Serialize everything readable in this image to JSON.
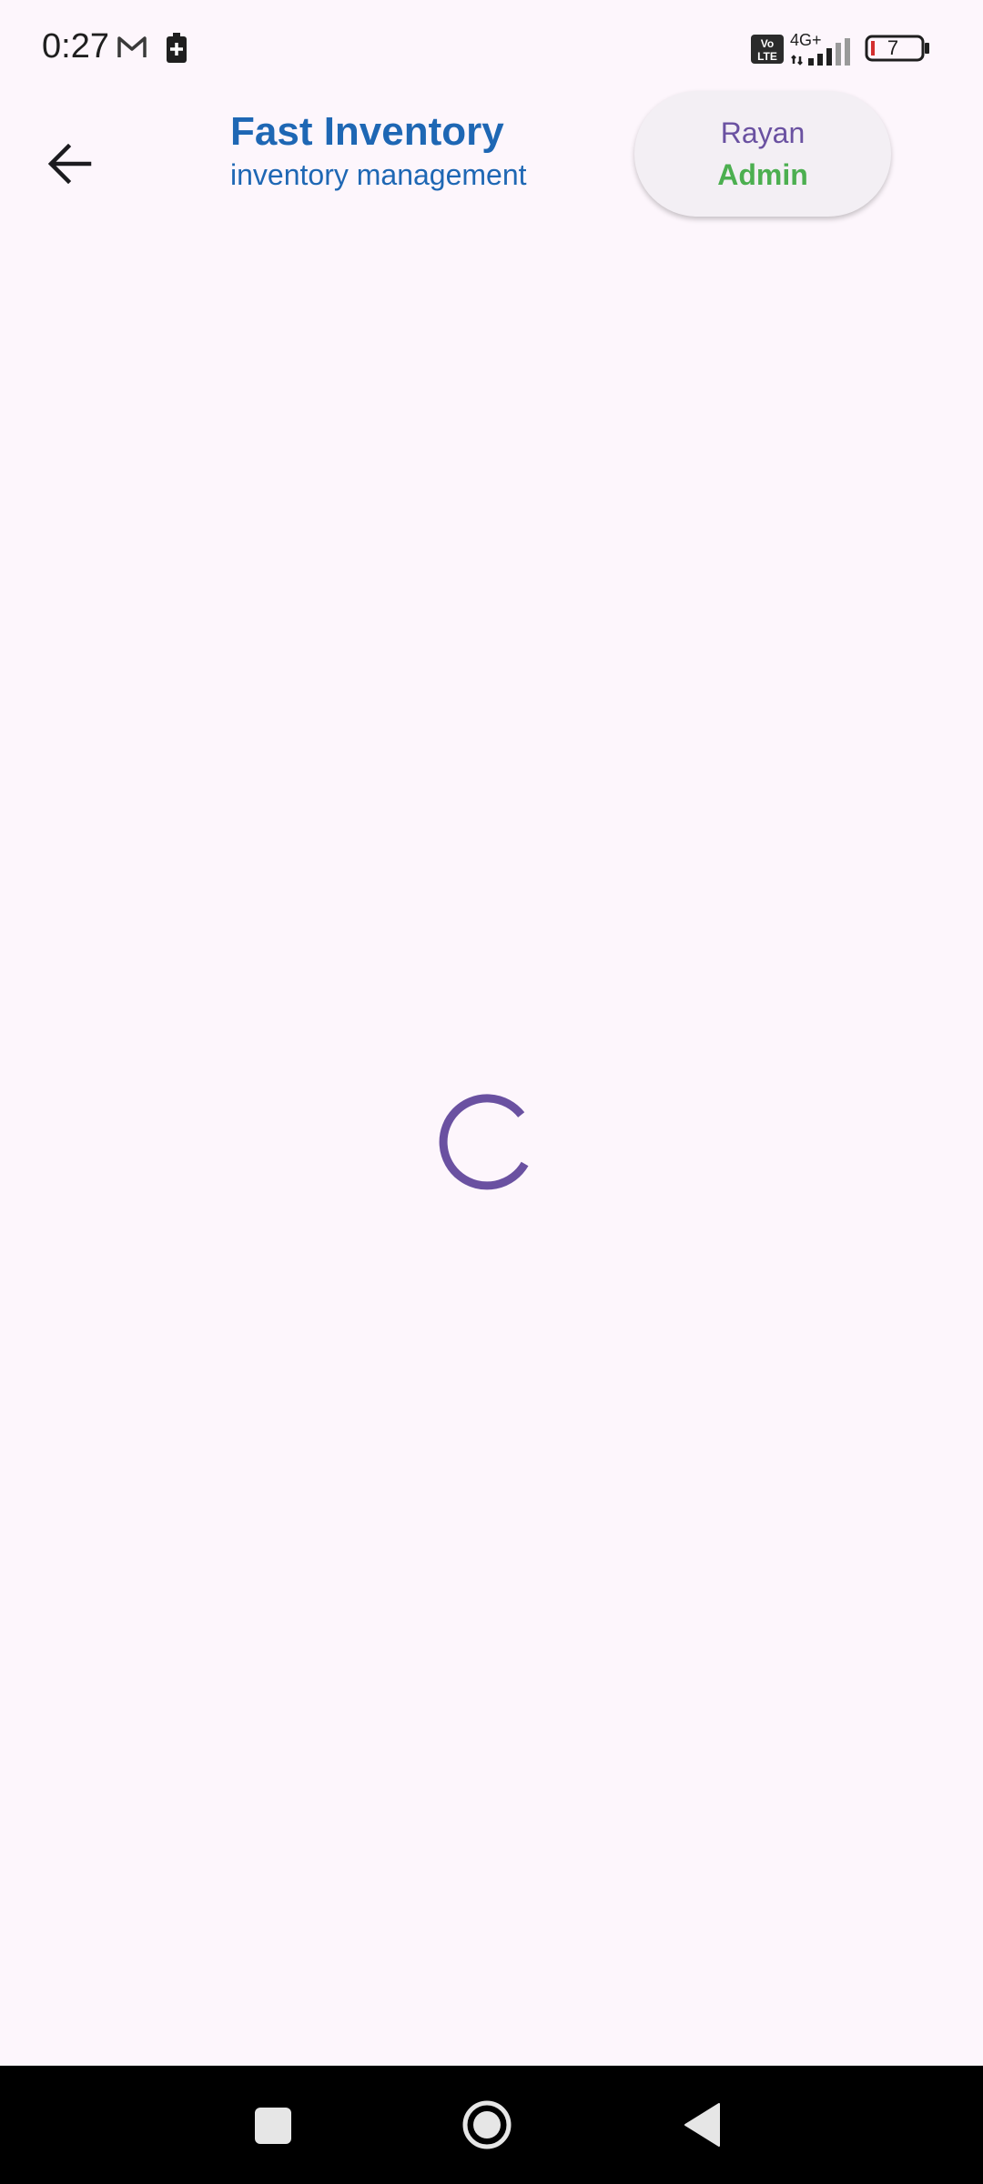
{
  "status_bar": {
    "time": "0:27",
    "network_type": "4G+",
    "battery_level": "7",
    "icons": [
      "gmail-icon",
      "battery-saver-icon",
      "volte-icon",
      "signal-icon",
      "battery-icon"
    ]
  },
  "app_bar": {
    "title": "Fast Inventory",
    "subtitle": "inventory management",
    "back_icon": "arrow-back-icon",
    "user": {
      "name": "Rayan",
      "role": "Admin"
    }
  },
  "content": {
    "loading_icon": "loading-spinner"
  },
  "nav_bar": {
    "icons": [
      "recents-icon",
      "home-icon",
      "back-icon"
    ]
  },
  "colors": {
    "background": "#fdf6fc",
    "title": "#1e67b4",
    "user_name": "#6a51a1",
    "user_role": "#4caf50",
    "spinner": "#6a51a1",
    "nav_bar": "#000000"
  }
}
